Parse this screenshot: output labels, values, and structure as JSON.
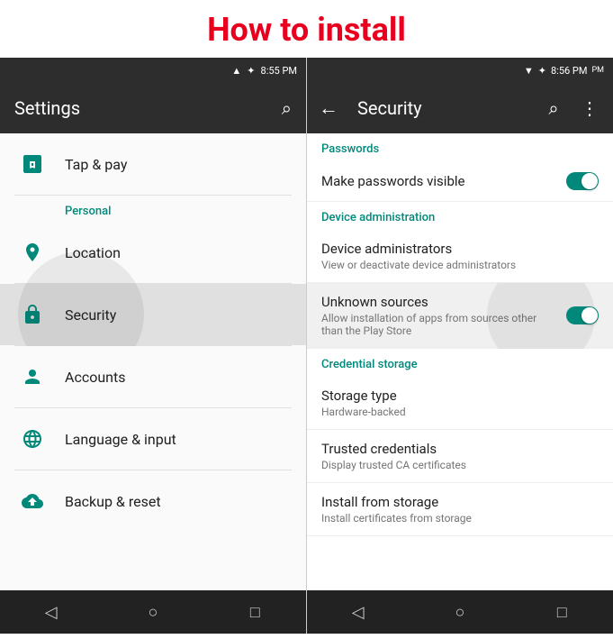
{
  "page": {
    "title": "How to install"
  },
  "left": {
    "status_time": "8:55 PM",
    "header_title": "Settings",
    "search_icon": "⌕",
    "section_personal": "Personal",
    "items": [
      {
        "id": "tap-pay",
        "label": "Tap & pay",
        "icon": "tap"
      },
      {
        "id": "location",
        "label": "Location",
        "icon": "location"
      },
      {
        "id": "security",
        "label": "Security",
        "icon": "lock",
        "active": true
      },
      {
        "id": "accounts",
        "label": "Accounts",
        "icon": "account"
      },
      {
        "id": "language",
        "label": "Language & input",
        "icon": "language"
      },
      {
        "id": "backup",
        "label": "Backup & reset",
        "icon": "backup"
      }
    ],
    "nav": [
      "◁",
      "○",
      "□"
    ]
  },
  "right": {
    "status_time": "8:56 PM",
    "header_title": "Security",
    "sections": [
      {
        "id": "passwords",
        "label": "Passwords",
        "items": [
          {
            "id": "make-passwords-visible",
            "title": "Make passwords visible",
            "subtitle": "",
            "toggle": true,
            "toggle_on": true
          }
        ]
      },
      {
        "id": "device-administration",
        "label": "Device administration",
        "items": [
          {
            "id": "device-administrators",
            "title": "Device administrators",
            "subtitle": "View or deactivate device administrators",
            "toggle": false
          },
          {
            "id": "unknown-sources",
            "title": "Unknown sources",
            "subtitle": "Allow installation of apps from sources other than the Play Store",
            "toggle": true,
            "toggle_on": true,
            "highlighted": true
          }
        ]
      },
      {
        "id": "credential-storage",
        "label": "Credential storage",
        "items": [
          {
            "id": "storage-type",
            "title": "Storage type",
            "subtitle": "Hardware-backed",
            "toggle": false
          },
          {
            "id": "trusted-credentials",
            "title": "Trusted credentials",
            "subtitle": "Display trusted CA certificates",
            "toggle": false
          },
          {
            "id": "install-from-storage",
            "title": "Install from storage",
            "subtitle": "Install certificates from storage",
            "toggle": false
          }
        ]
      }
    ],
    "nav": [
      "◁",
      "○",
      "□"
    ]
  }
}
